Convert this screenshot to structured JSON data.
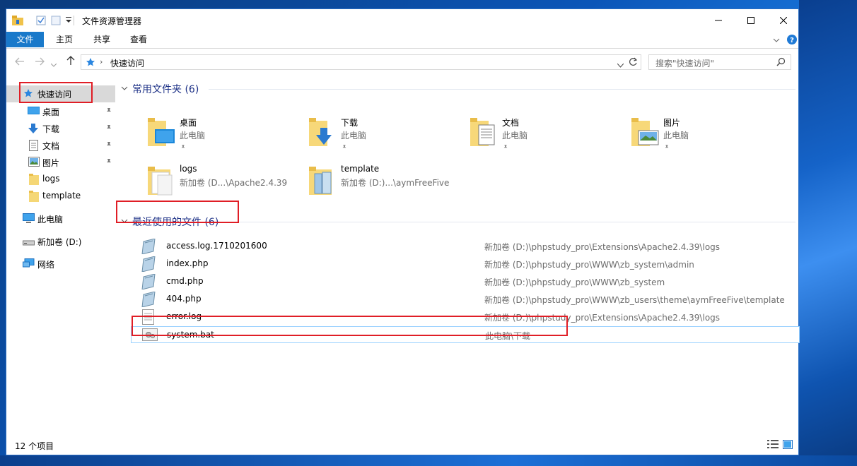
{
  "window": {
    "title": "文件资源管理器",
    "controls": {
      "minimize": "—",
      "maximize": "☐",
      "close": "✕"
    }
  },
  "ribbon": {
    "tabs": [
      "文件",
      "主页",
      "共享",
      "查看"
    ]
  },
  "address": {
    "path": "快速访问"
  },
  "search": {
    "placeholder": "搜索\"快速访问\""
  },
  "nav": {
    "items": [
      {
        "label": "快速访问",
        "icon": "star-icon",
        "pinned": false
      },
      {
        "label": "桌面",
        "icon": "desktop-icon",
        "pinned": true
      },
      {
        "label": "下载",
        "icon": "download-icon",
        "pinned": true
      },
      {
        "label": "文档",
        "icon": "document-icon",
        "pinned": true
      },
      {
        "label": "图片",
        "icon": "picture-icon",
        "pinned": true
      },
      {
        "label": "logs",
        "icon": "folder-icon",
        "pinned": false
      },
      {
        "label": "template",
        "icon": "folder-icon",
        "pinned": false
      },
      {
        "label": "此电脑",
        "icon": "computer-icon",
        "pinned": false
      },
      {
        "label": "新加卷 (D:)",
        "icon": "drive-icon",
        "pinned": false
      },
      {
        "label": "网络",
        "icon": "network-icon",
        "pinned": false
      }
    ]
  },
  "frequent": {
    "header": "常用文件夹 (6)",
    "folders": [
      {
        "name": "桌面",
        "location": "此电脑",
        "pinned": true
      },
      {
        "name": "下载",
        "location": "此电脑",
        "pinned": true
      },
      {
        "name": "文档",
        "location": "此电脑",
        "pinned": true
      },
      {
        "name": "图片",
        "location": "此电脑",
        "pinned": true
      },
      {
        "name": "logs",
        "location": "新加卷 (D...\\Apache2.4.39",
        "pinned": false
      },
      {
        "name": "template",
        "location": "新加卷 (D:)...\\aymFreeFive",
        "pinned": false
      }
    ]
  },
  "recent": {
    "header": "最近使用的文件 (6)",
    "files": [
      {
        "name": "access.log.1710201600",
        "path": "新加卷 (D:)\\phpstudy_pro\\Extensions\\Apache2.4.39\\logs",
        "icon": "script-file-icon"
      },
      {
        "name": "index.php",
        "path": "新加卷 (D:)\\phpstudy_pro\\WWW\\zb_system\\admin",
        "icon": "script-file-icon"
      },
      {
        "name": "cmd.php",
        "path": "新加卷 (D:)\\phpstudy_pro\\WWW\\zb_system",
        "icon": "script-file-icon"
      },
      {
        "name": "404.php",
        "path": "新加卷 (D:)\\phpstudy_pro\\WWW\\zb_users\\theme\\aymFreeFive\\template",
        "icon": "script-file-icon"
      },
      {
        "name": "error.log",
        "path": "新加卷 (D:)\\phpstudy_pro\\Extensions\\Apache2.4.39\\logs",
        "icon": "text-file-icon"
      },
      {
        "name": "system.bat",
        "path": "此电脑\\下载",
        "icon": "batch-file-icon"
      }
    ]
  },
  "status": {
    "count": "12 个项目"
  },
  "colors": {
    "accent": "#1979ca",
    "group_header": "#1e3287",
    "highlight": "#e01e26"
  }
}
